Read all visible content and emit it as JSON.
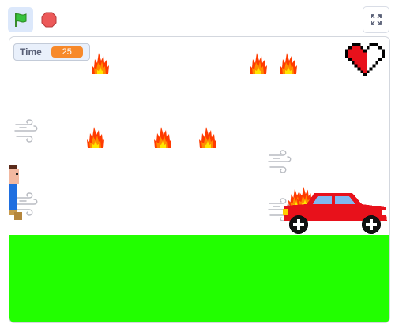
{
  "toolbar": {
    "flag_icon": "green-flag-icon",
    "stop_icon": "stop-sign-icon",
    "fullscreen_icon": "fullscreen-icon"
  },
  "monitor": {
    "label": "Time",
    "value": "25"
  },
  "colors": {
    "flag_bg": "#dce8fb",
    "flag_green": "#37c23f",
    "stop_red": "#ec5959",
    "monitor_orange": "#f7892a",
    "ground_green": "#22ff00",
    "car_red": "#e8111b",
    "car_window": "#7fb8f0",
    "fire_red": "#ff3b00",
    "fire_orange": "#ff8c00",
    "fire_yellow": "#ffe600",
    "heart_red": "#e8111b"
  },
  "game": {
    "sprites": [
      "flame",
      "flame",
      "flame",
      "flame",
      "flame",
      "flame",
      "flame",
      "flame",
      "wind-gust",
      "wind-gust",
      "wind-gust",
      "wind-gust",
      "player",
      "car",
      "heart"
    ]
  }
}
